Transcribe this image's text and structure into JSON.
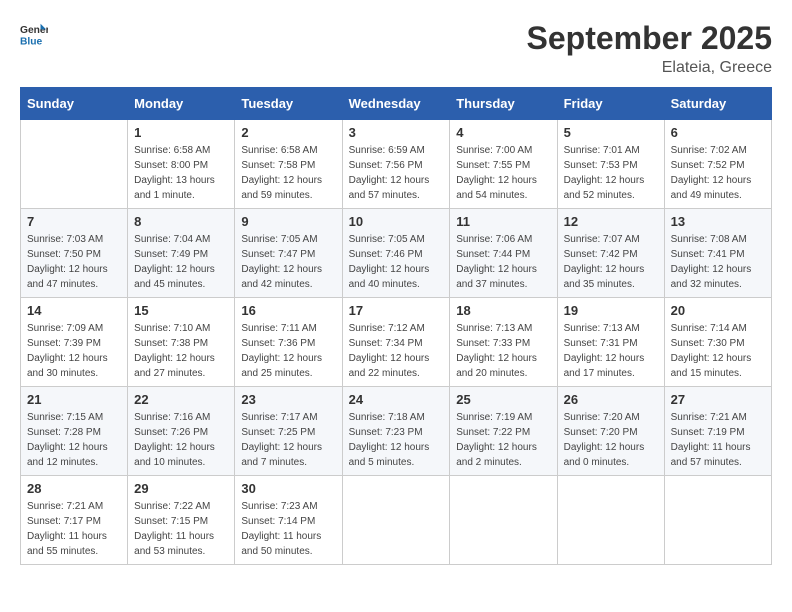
{
  "header": {
    "logo_general": "General",
    "logo_blue": "Blue",
    "month_title": "September 2025",
    "location": "Elateia, Greece"
  },
  "days_of_week": [
    "Sunday",
    "Monday",
    "Tuesday",
    "Wednesday",
    "Thursday",
    "Friday",
    "Saturday"
  ],
  "weeks": [
    [
      {
        "day": "",
        "info": ""
      },
      {
        "day": "1",
        "info": "Sunrise: 6:58 AM\nSunset: 8:00 PM\nDaylight: 13 hours\nand 1 minute."
      },
      {
        "day": "2",
        "info": "Sunrise: 6:58 AM\nSunset: 7:58 PM\nDaylight: 12 hours\nand 59 minutes."
      },
      {
        "day": "3",
        "info": "Sunrise: 6:59 AM\nSunset: 7:56 PM\nDaylight: 12 hours\nand 57 minutes."
      },
      {
        "day": "4",
        "info": "Sunrise: 7:00 AM\nSunset: 7:55 PM\nDaylight: 12 hours\nand 54 minutes."
      },
      {
        "day": "5",
        "info": "Sunrise: 7:01 AM\nSunset: 7:53 PM\nDaylight: 12 hours\nand 52 minutes."
      },
      {
        "day": "6",
        "info": "Sunrise: 7:02 AM\nSunset: 7:52 PM\nDaylight: 12 hours\nand 49 minutes."
      }
    ],
    [
      {
        "day": "7",
        "info": "Sunrise: 7:03 AM\nSunset: 7:50 PM\nDaylight: 12 hours\nand 47 minutes."
      },
      {
        "day": "8",
        "info": "Sunrise: 7:04 AM\nSunset: 7:49 PM\nDaylight: 12 hours\nand 45 minutes."
      },
      {
        "day": "9",
        "info": "Sunrise: 7:05 AM\nSunset: 7:47 PM\nDaylight: 12 hours\nand 42 minutes."
      },
      {
        "day": "10",
        "info": "Sunrise: 7:05 AM\nSunset: 7:46 PM\nDaylight: 12 hours\nand 40 minutes."
      },
      {
        "day": "11",
        "info": "Sunrise: 7:06 AM\nSunset: 7:44 PM\nDaylight: 12 hours\nand 37 minutes."
      },
      {
        "day": "12",
        "info": "Sunrise: 7:07 AM\nSunset: 7:42 PM\nDaylight: 12 hours\nand 35 minutes."
      },
      {
        "day": "13",
        "info": "Sunrise: 7:08 AM\nSunset: 7:41 PM\nDaylight: 12 hours\nand 32 minutes."
      }
    ],
    [
      {
        "day": "14",
        "info": "Sunrise: 7:09 AM\nSunset: 7:39 PM\nDaylight: 12 hours\nand 30 minutes."
      },
      {
        "day": "15",
        "info": "Sunrise: 7:10 AM\nSunset: 7:38 PM\nDaylight: 12 hours\nand 27 minutes."
      },
      {
        "day": "16",
        "info": "Sunrise: 7:11 AM\nSunset: 7:36 PM\nDaylight: 12 hours\nand 25 minutes."
      },
      {
        "day": "17",
        "info": "Sunrise: 7:12 AM\nSunset: 7:34 PM\nDaylight: 12 hours\nand 22 minutes."
      },
      {
        "day": "18",
        "info": "Sunrise: 7:13 AM\nSunset: 7:33 PM\nDaylight: 12 hours\nand 20 minutes."
      },
      {
        "day": "19",
        "info": "Sunrise: 7:13 AM\nSunset: 7:31 PM\nDaylight: 12 hours\nand 17 minutes."
      },
      {
        "day": "20",
        "info": "Sunrise: 7:14 AM\nSunset: 7:30 PM\nDaylight: 12 hours\nand 15 minutes."
      }
    ],
    [
      {
        "day": "21",
        "info": "Sunrise: 7:15 AM\nSunset: 7:28 PM\nDaylight: 12 hours\nand 12 minutes."
      },
      {
        "day": "22",
        "info": "Sunrise: 7:16 AM\nSunset: 7:26 PM\nDaylight: 12 hours\nand 10 minutes."
      },
      {
        "day": "23",
        "info": "Sunrise: 7:17 AM\nSunset: 7:25 PM\nDaylight: 12 hours\nand 7 minutes."
      },
      {
        "day": "24",
        "info": "Sunrise: 7:18 AM\nSunset: 7:23 PM\nDaylight: 12 hours\nand 5 minutes."
      },
      {
        "day": "25",
        "info": "Sunrise: 7:19 AM\nSunset: 7:22 PM\nDaylight: 12 hours\nand 2 minutes."
      },
      {
        "day": "26",
        "info": "Sunrise: 7:20 AM\nSunset: 7:20 PM\nDaylight: 12 hours\nand 0 minutes."
      },
      {
        "day": "27",
        "info": "Sunrise: 7:21 AM\nSunset: 7:19 PM\nDaylight: 11 hours\nand 57 minutes."
      }
    ],
    [
      {
        "day": "28",
        "info": "Sunrise: 7:21 AM\nSunset: 7:17 PM\nDaylight: 11 hours\nand 55 minutes."
      },
      {
        "day": "29",
        "info": "Sunrise: 7:22 AM\nSunset: 7:15 PM\nDaylight: 11 hours\nand 53 minutes."
      },
      {
        "day": "30",
        "info": "Sunrise: 7:23 AM\nSunset: 7:14 PM\nDaylight: 11 hours\nand 50 minutes."
      },
      {
        "day": "",
        "info": ""
      },
      {
        "day": "",
        "info": ""
      },
      {
        "day": "",
        "info": ""
      },
      {
        "day": "",
        "info": ""
      }
    ]
  ]
}
